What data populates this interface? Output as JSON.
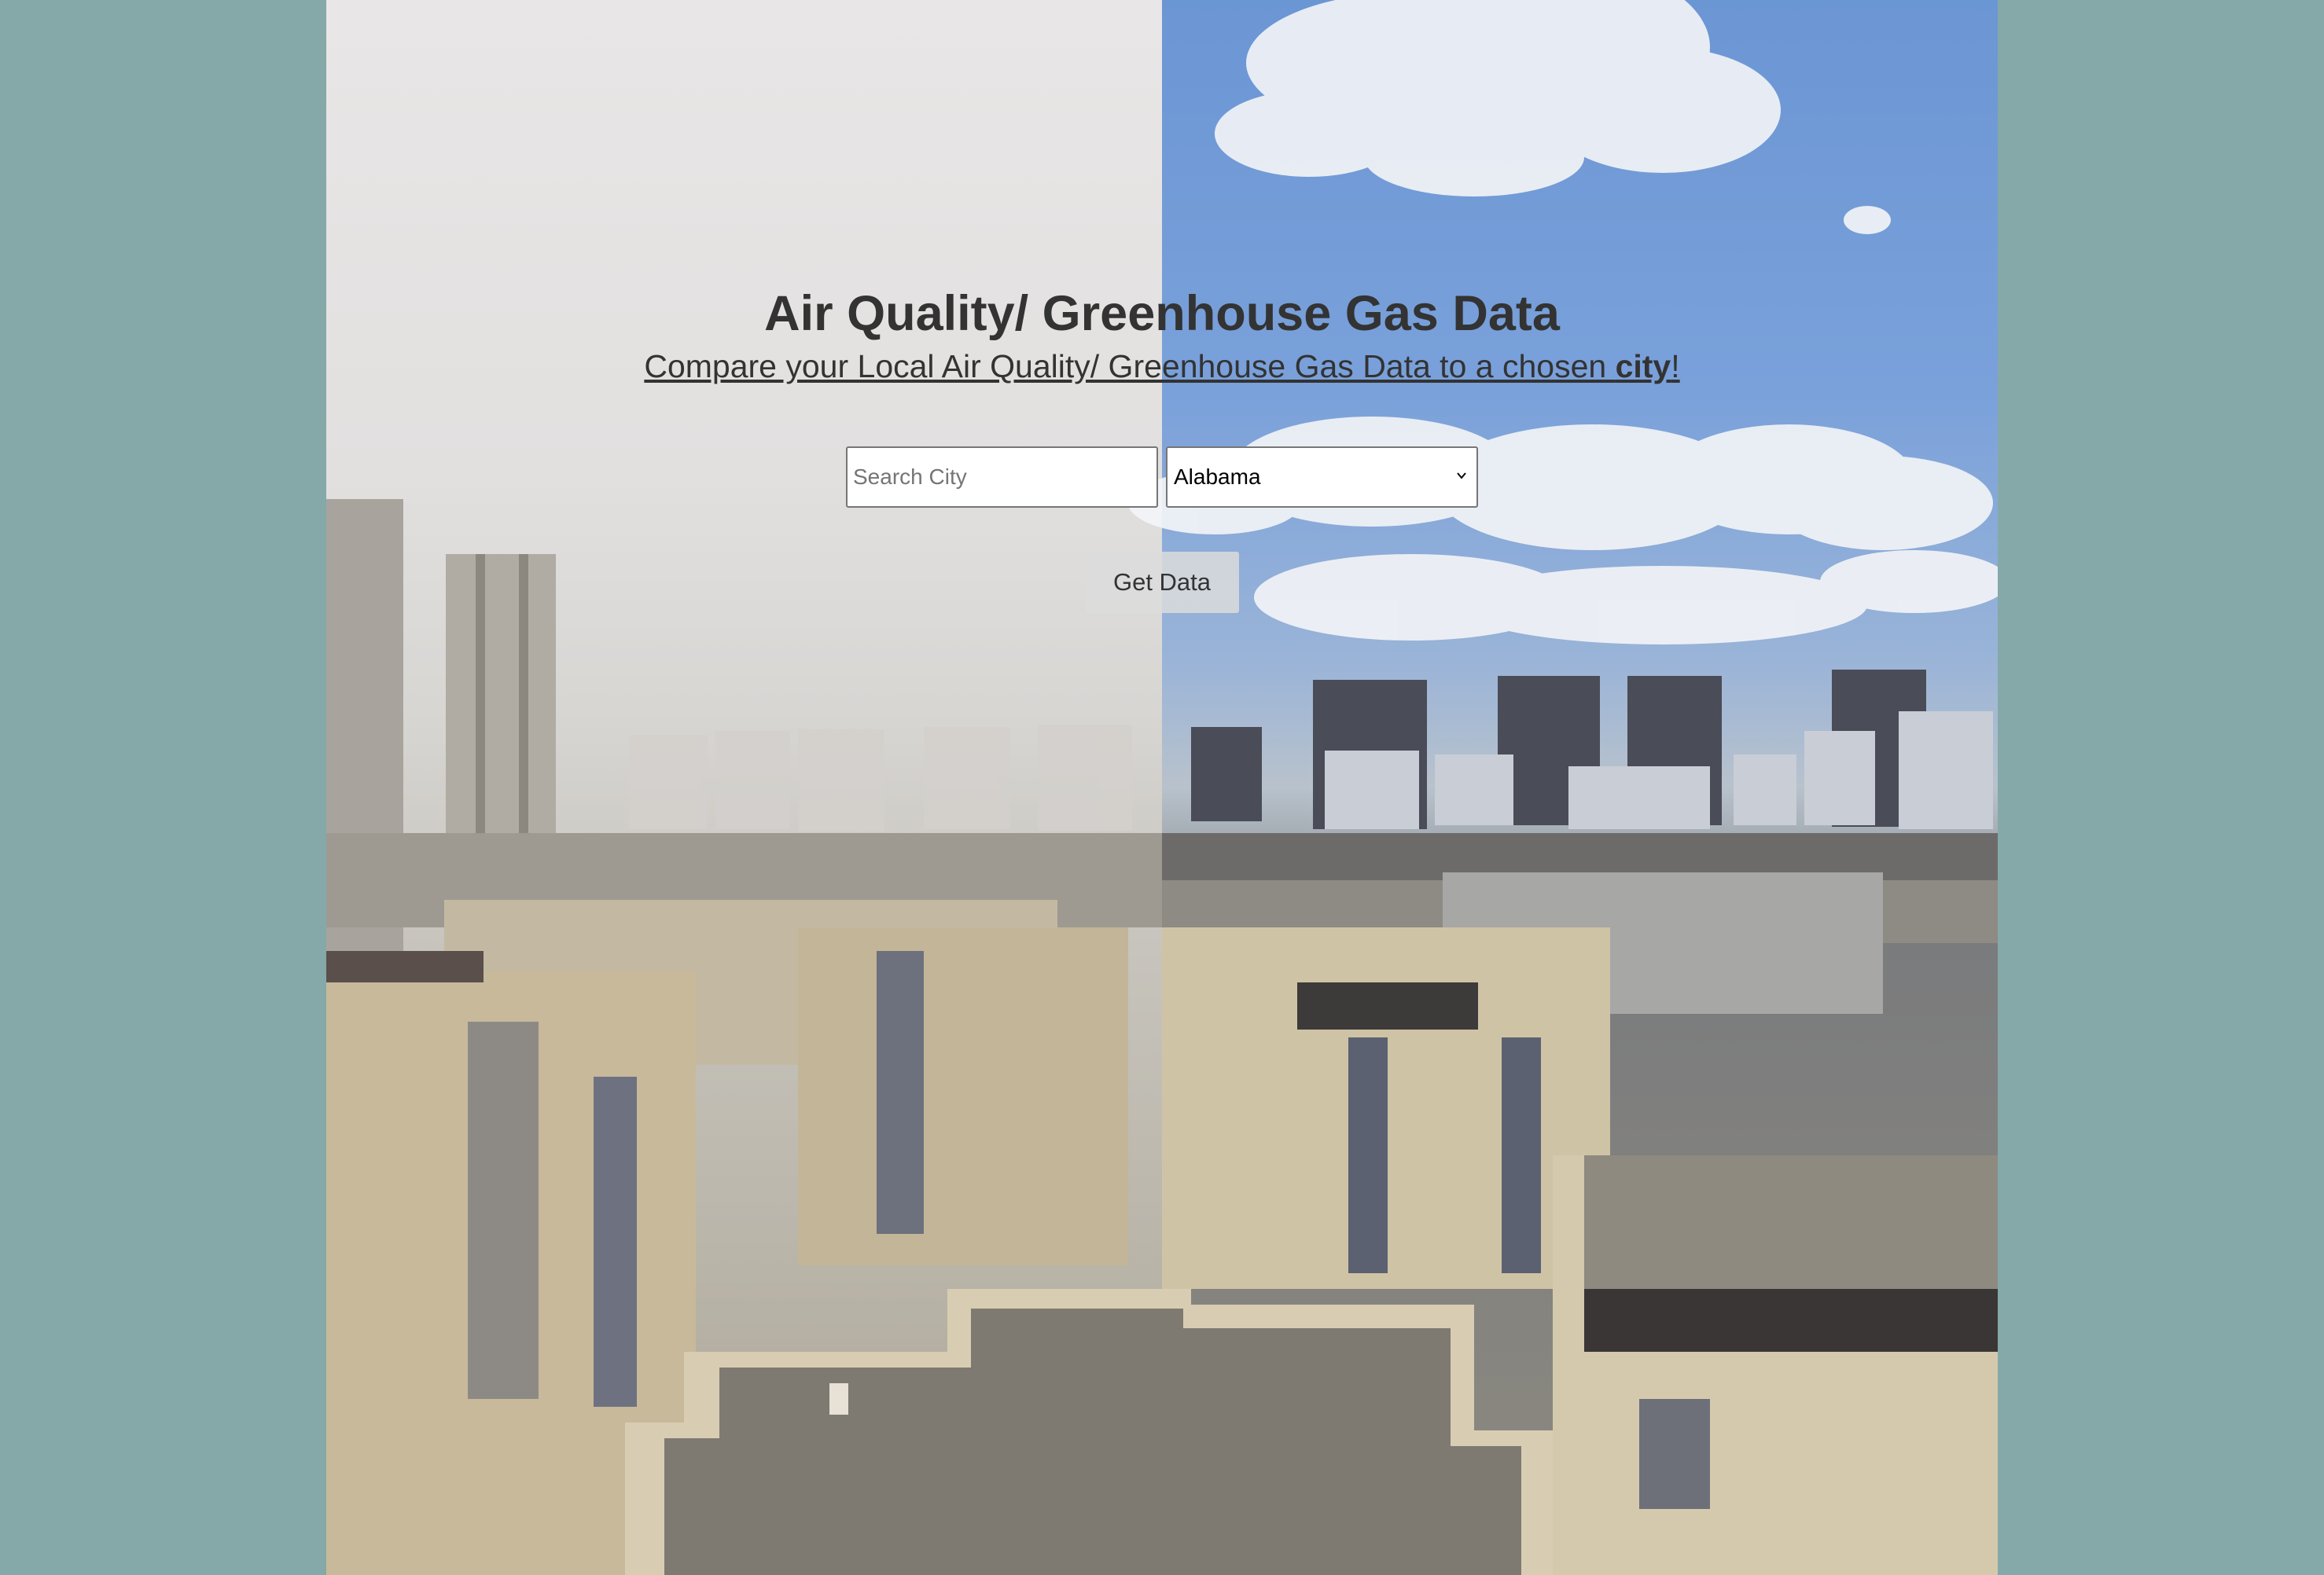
{
  "header": {
    "title": "Air Quality/ Greenhouse Gas Data",
    "subtitle_part1": "Compare your Local Air Quality/ Greenhouse Gas Data to a chosen ",
    "subtitle_bold": "city",
    "subtitle_part2": "!"
  },
  "form": {
    "search_placeholder": "Search City",
    "search_value": "",
    "state_selected": "Alabama",
    "button_label": "Get Data"
  },
  "colors": {
    "page_background": "#84a9a8",
    "text": "#333333"
  },
  "hero_image": {
    "left_half": "hazy-city-skyline",
    "right_half": "clear-sky-city-skyline"
  }
}
